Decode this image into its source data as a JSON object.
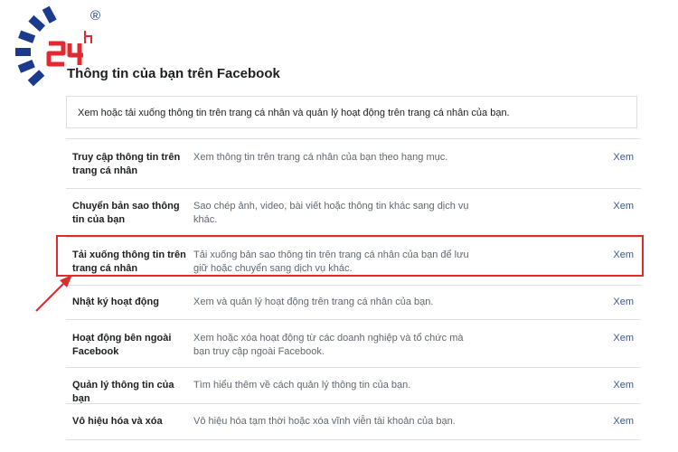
{
  "logo": {
    "text": "24h",
    "mark": "®",
    "accent": "#1a3a8c",
    "red": "#e02a30"
  },
  "page": {
    "title": "Thông tin của bạn trên Facebook",
    "intro": "Xem hoặc tải xuống thông tin trên trang cá nhân và quản lý hoạt động trên trang cá nhân của bạn."
  },
  "settings": {
    "items": [
      {
        "name": "Truy cập thông tin trên trang cá nhân",
        "description": "Xem thông tin trên trang cá nhân của bạn theo hạng mục.",
        "link": "Xem"
      },
      {
        "name": "Chuyển bản sao thông tin của bạn",
        "description": "Sao chép ảnh, video, bài viết hoặc thông tin khác sang dịch vụ khác.",
        "link": "Xem"
      },
      {
        "name": "Tải xuống thông tin trên trang cá nhân",
        "description": "Tải xuống bản sao thông tin trên trang cá nhân của bạn để lưu giữ hoặc chuyển sang dịch vụ khác.",
        "link": "Xem"
      },
      {
        "name": "Nhật ký hoạt động",
        "description": "Xem và quản lý hoạt động trên trang cá nhân của bạn.",
        "link": "Xem"
      },
      {
        "name": "Hoạt động bên ngoài Facebook",
        "description": "Xem hoặc xóa hoạt động từ các doanh nghiệp và tổ chức mà bạn truy cập ngoài Facebook.",
        "link": "Xem"
      },
      {
        "name": "Quản lý thông tin của bạn",
        "description": "Tìm hiểu thêm về cách quản lý thông tin của bạn.",
        "link": "Xem"
      },
      {
        "name": "Vô hiệu hóa và xóa",
        "description": "Vô hiệu hóa tạm thời hoặc xóa vĩnh viễn tài khoản của bạn.",
        "link": "Xem"
      }
    ]
  },
  "colors": {
    "link": "#385898",
    "highlight": "#e02a30",
    "border": "#dddfe2"
  }
}
